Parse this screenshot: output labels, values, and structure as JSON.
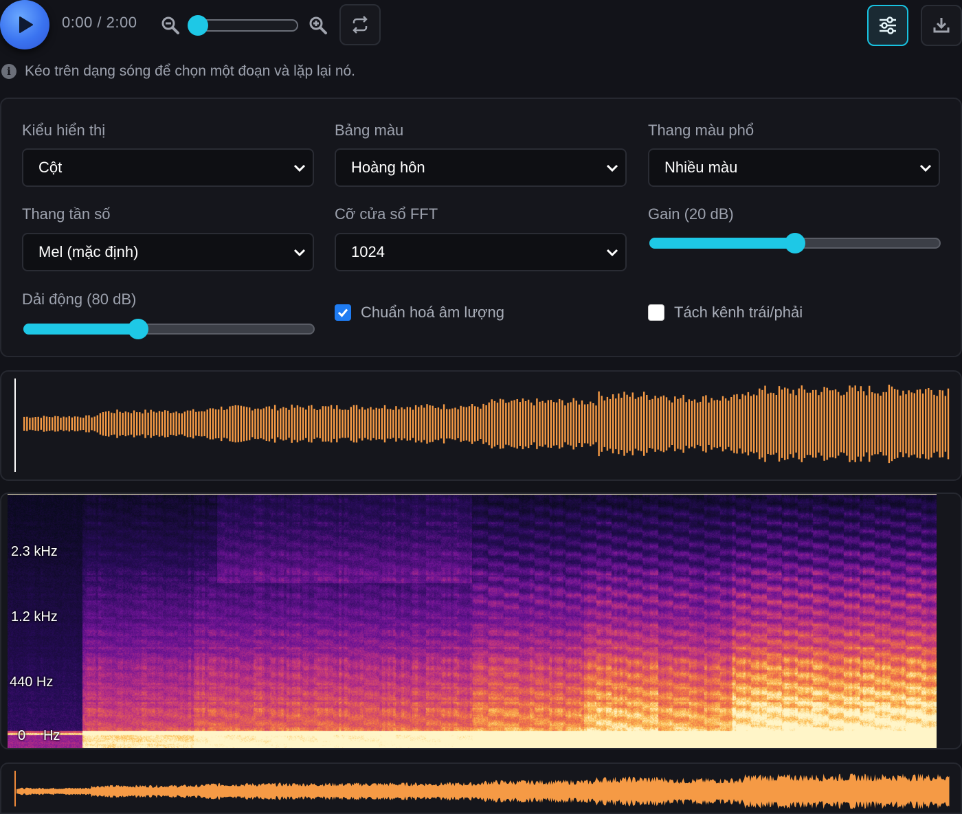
{
  "player": {
    "time": "0:00 / 2:00",
    "zoom_level": 0.0
  },
  "hint": {
    "text": "Kéo trên dạng sóng để chọn một đoạn và lặp lại nó."
  },
  "settings": {
    "display_mode": {
      "label": "Kiểu hiển thị",
      "value": "Cột"
    },
    "palette": {
      "label": "Bảng màu",
      "value": "Hoàng hôn"
    },
    "spectrum_scale": {
      "label": "Thang màu phổ",
      "value": "Nhiều màu"
    },
    "frequency_scale": {
      "label": "Thang tần số",
      "value": "Mel (mặc định)"
    },
    "fft_size": {
      "label": "Cỡ cửa sổ FFT",
      "value": "1024"
    },
    "gain": {
      "label": "Gain (20 dB)",
      "fraction": 0.5
    },
    "dynamic_range": {
      "label": "Dải động (80 dB)",
      "fraction": 0.385
    },
    "normalize": {
      "label": "Chuẩn hoá âm lượng",
      "checked": true
    },
    "split_channels": {
      "label": "Tách kênh trái/phải",
      "checked": false
    }
  },
  "spectrogram": {
    "frequency_labels": [
      "2.3 kHz",
      "1.2 kHz",
      "440 Hz",
      "0"
    ],
    "hz_unit": "Hz"
  },
  "colors": {
    "accent": "#1ec8e6",
    "waveform": "#f59a45",
    "play": "#3a73f0"
  }
}
